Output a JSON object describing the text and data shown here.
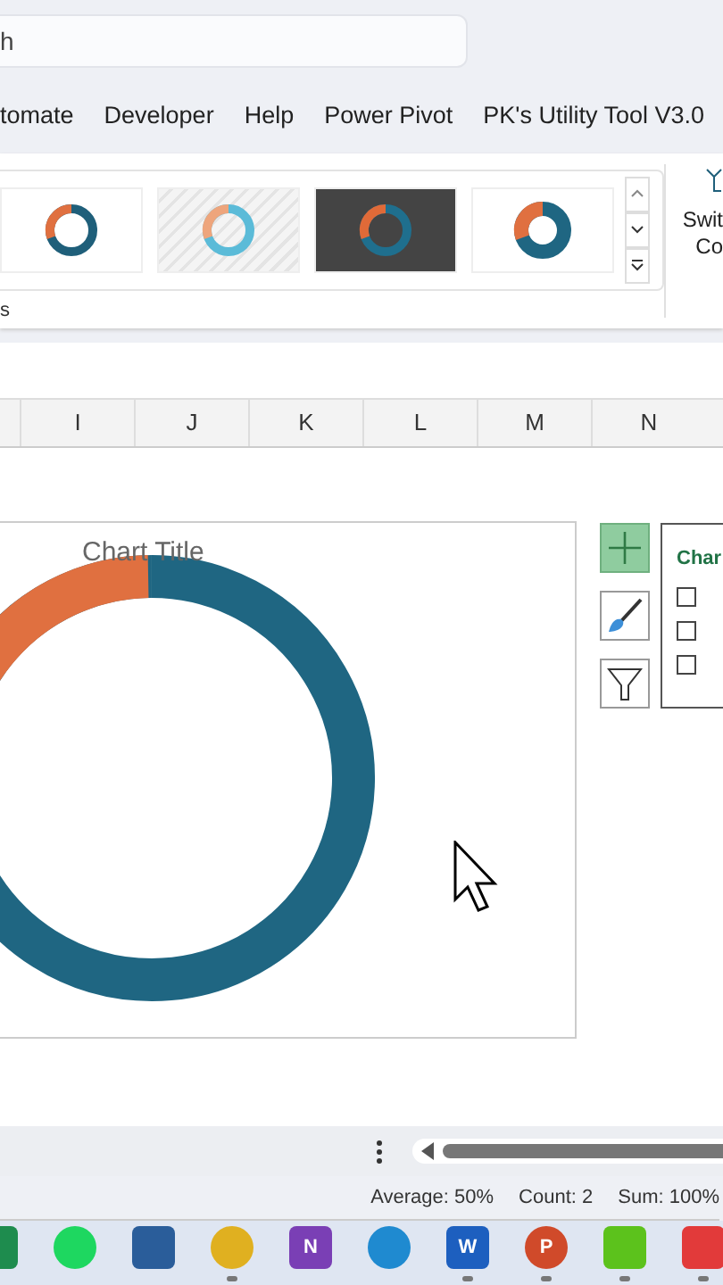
{
  "search": {
    "value": "h"
  },
  "ribbon_tabs": [
    {
      "label": "tomate"
    },
    {
      "label": "Developer"
    },
    {
      "label": "Help"
    },
    {
      "label": "Power Pivot"
    },
    {
      "label": "PK's Utility Tool V3.0"
    }
  ],
  "gallery": {
    "styles": [
      {
        "kind": "plain"
      },
      {
        "kind": "striped"
      },
      {
        "kind": "dark"
      },
      {
        "kind": "thick"
      }
    ],
    "group_label": "s"
  },
  "switch_button": {
    "line_1": "Swit",
    "line_2": "Co"
  },
  "columns": [
    "I",
    "J",
    "K",
    "L",
    "M",
    "N"
  ],
  "chart": {
    "title": "Chart Title"
  },
  "chart_elements_popup": {
    "title": "Char",
    "items": [
      {
        "checked": false
      },
      {
        "checked": false
      },
      {
        "checked": false
      }
    ]
  },
  "status_bar": [
    "Average: 50%",
    "Count: 2",
    "Sum: 100%"
  ],
  "taskbar": [
    {
      "kind": "sheets",
      "running": false
    },
    {
      "kind": "music",
      "running": false
    },
    {
      "kind": "store",
      "running": false
    },
    {
      "kind": "browser",
      "running": true
    },
    {
      "kind": "notes",
      "label": "N",
      "running": false
    },
    {
      "kind": "edge",
      "running": false
    },
    {
      "kind": "word",
      "label": "W",
      "running": true
    },
    {
      "kind": "slides",
      "label": "P",
      "running": true
    },
    {
      "kind": "green-c",
      "running": true
    },
    {
      "kind": "red-c",
      "running": true
    }
  ]
}
